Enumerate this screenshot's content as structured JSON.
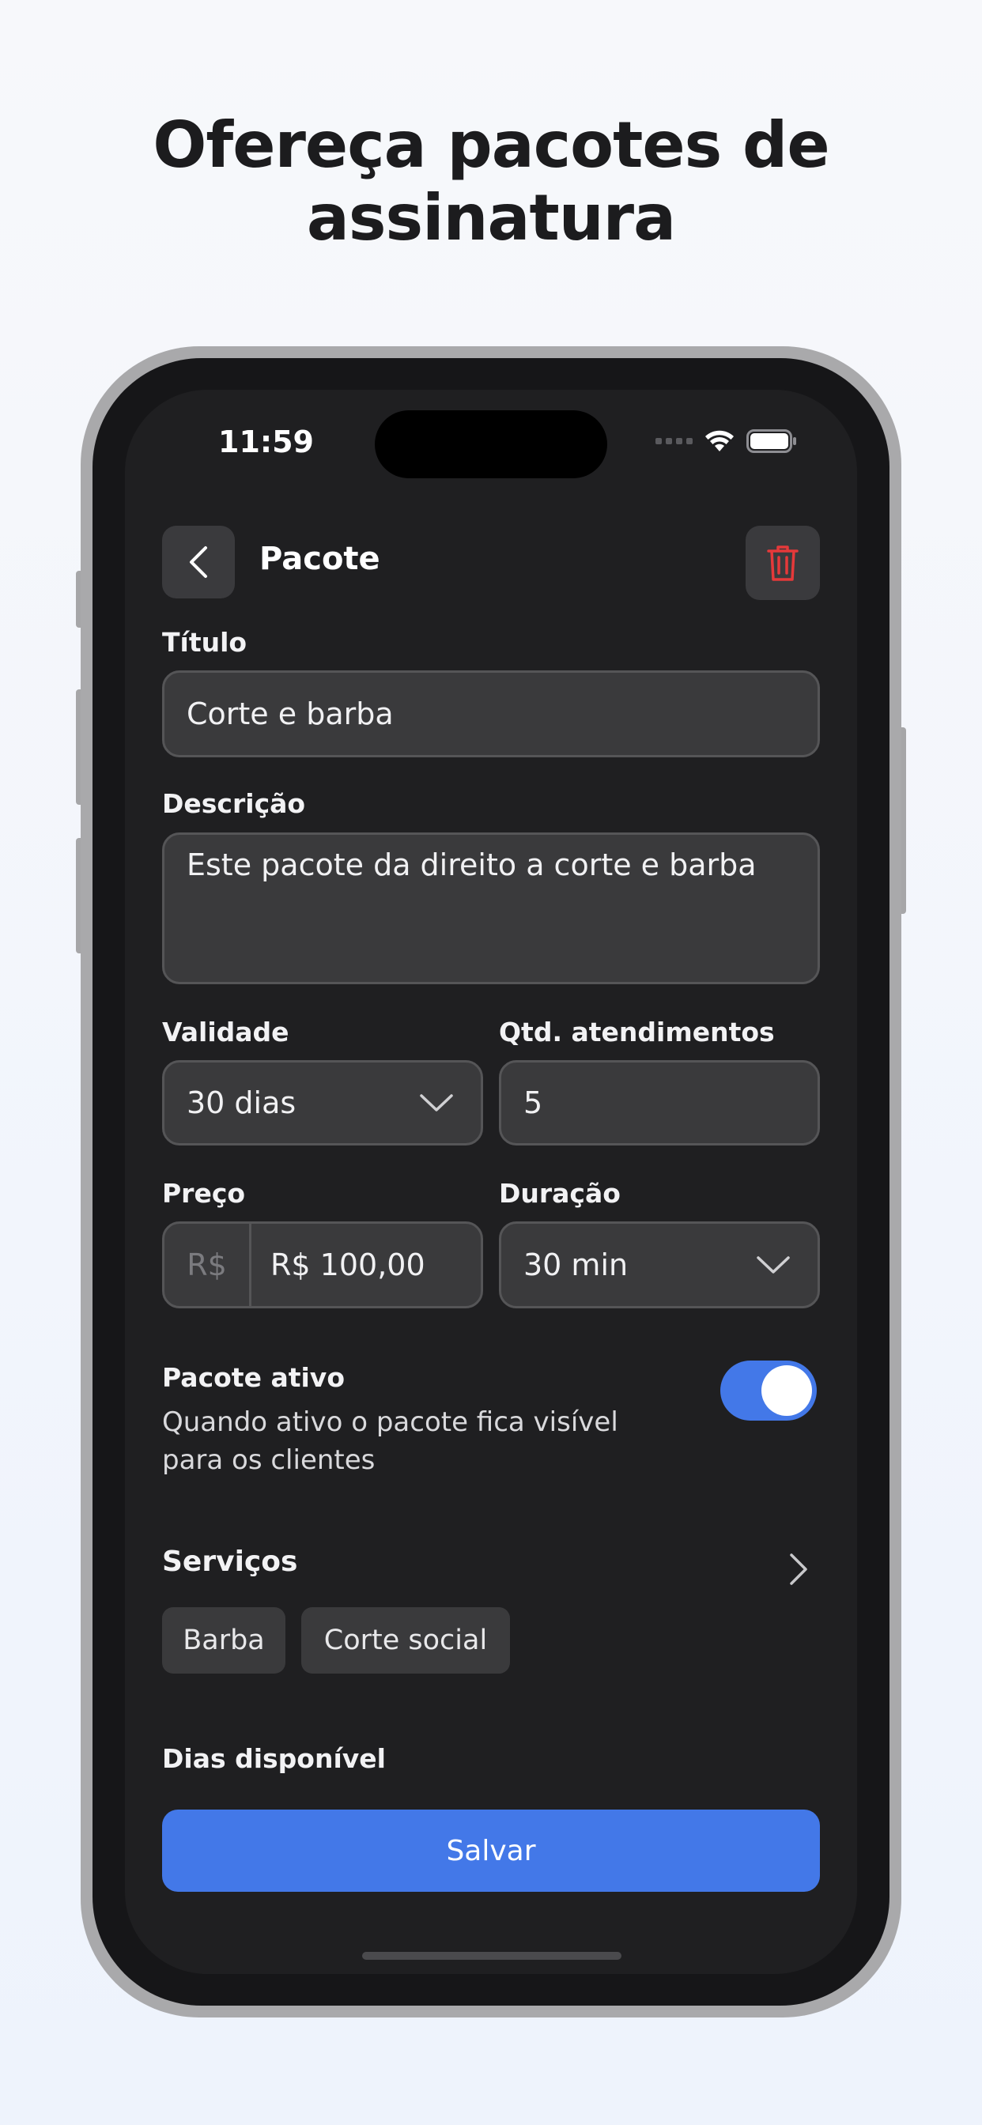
{
  "headline": {
    "line1": "Ofereça pacotes de",
    "line2": "assinatura"
  },
  "status_bar": {
    "time": "11:59"
  },
  "header": {
    "title": "Pacote"
  },
  "form": {
    "titulo": {
      "label": "Título",
      "value": "Corte e barba"
    },
    "descricao": {
      "label": "Descrição",
      "value": "Este pacote da direito a corte e barba"
    },
    "validade": {
      "label": "Validade",
      "value": "30 dias"
    },
    "qtd_atendimentos": {
      "label": "Qtd. atendimentos",
      "value": "5"
    },
    "preco": {
      "label": "Preço",
      "prefix": "R$",
      "value": "R$ 100,00"
    },
    "duracao": {
      "label": "Duração",
      "value": "30 min"
    }
  },
  "pacote_ativo": {
    "label": "Pacote ativo",
    "description_line1": "Quando ativo o pacote fica visível",
    "description_line2": "para os clientes",
    "enabled": true
  },
  "servicos": {
    "label": "Serviços",
    "chips": [
      "Barba",
      "Corte social"
    ]
  },
  "dias": {
    "label": "Dias disponível"
  },
  "save_label": "Salvar",
  "colors": {
    "accent": "#4378e8",
    "danger": "#e5393a",
    "screen_bg": "#1f1f21",
    "field_bg": "#3a3a3c"
  }
}
